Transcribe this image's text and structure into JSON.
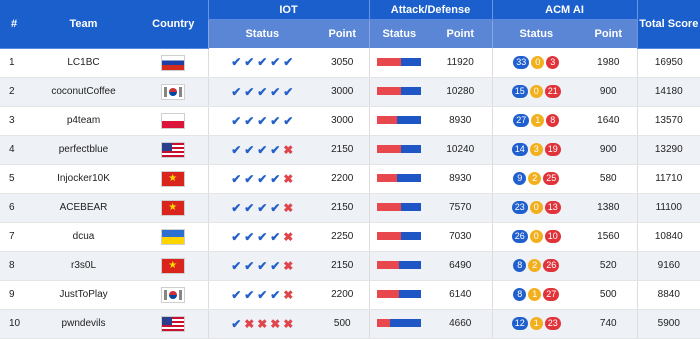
{
  "colors": {
    "header": "#1a5fcc",
    "subheader": "#5b86d6",
    "ok": "#2460c8",
    "bad": "#e0454b",
    "bar_red": "#e8484d",
    "bar_blue": "#1e56c6",
    "pill_blue": "#1f5fce",
    "pill_yellow": "#f2b01e",
    "pill_red": "#e0333a"
  },
  "headers": {
    "rank": "#",
    "team": "Team",
    "country": "Country",
    "iot": "IOT",
    "attack_defense": "Attack/Defense",
    "acm_ai": "ACM AI",
    "total": "Total Score",
    "status": "Status",
    "point": "Point"
  },
  "rows": [
    {
      "rank": "1",
      "team": "LC1BC",
      "country": "ru",
      "iot": [
        "ok",
        "ok",
        "ok",
        "ok",
        "ok"
      ],
      "iot_point": "3050",
      "ad_red_pct": 0.55,
      "ad_point": "11920",
      "acm": [
        "33",
        "0",
        "3"
      ],
      "acm_point": "1980",
      "total": "16950"
    },
    {
      "rank": "2",
      "team": "coconutCoffee",
      "country": "kr",
      "iot": [
        "ok",
        "ok",
        "ok",
        "ok",
        "ok"
      ],
      "iot_point": "3000",
      "ad_red_pct": 0.55,
      "ad_point": "10280",
      "acm": [
        "15",
        "0",
        "21"
      ],
      "acm_point": "900",
      "total": "14180"
    },
    {
      "rank": "3",
      "team": "p4team",
      "country": "pl",
      "iot": [
        "ok",
        "ok",
        "ok",
        "ok",
        "ok"
      ],
      "iot_point": "3000",
      "ad_red_pct": 0.45,
      "ad_point": "8930",
      "acm": [
        "27",
        "1",
        "8"
      ],
      "acm_point": "1640",
      "total": "13570"
    },
    {
      "rank": "4",
      "team": "perfectblue",
      "country": "us",
      "iot": [
        "ok",
        "ok",
        "ok",
        "ok",
        "bad"
      ],
      "iot_point": "2150",
      "ad_red_pct": 0.55,
      "ad_point": "10240",
      "acm": [
        "14",
        "3",
        "19"
      ],
      "acm_point": "900",
      "total": "13290"
    },
    {
      "rank": "5",
      "team": "Injocker10K",
      "country": "vn",
      "iot": [
        "ok",
        "ok",
        "ok",
        "ok",
        "bad"
      ],
      "iot_point": "2200",
      "ad_red_pct": 0.45,
      "ad_point": "8930",
      "acm": [
        "9",
        "2",
        "25"
      ],
      "acm_point": "580",
      "total": "11710"
    },
    {
      "rank": "6",
      "team": "ACEBEAR",
      "country": "vn",
      "iot": [
        "ok",
        "ok",
        "ok",
        "ok",
        "bad"
      ],
      "iot_point": "2150",
      "ad_red_pct": 0.55,
      "ad_point": "7570",
      "acm": [
        "23",
        "0",
        "13"
      ],
      "acm_point": "1380",
      "total": "11100"
    },
    {
      "rank": "7",
      "team": "dcua",
      "country": "ua",
      "iot": [
        "ok",
        "ok",
        "ok",
        "ok",
        "bad"
      ],
      "iot_point": "2250",
      "ad_red_pct": 0.55,
      "ad_point": "7030",
      "acm": [
        "26",
        "0",
        "10"
      ],
      "acm_point": "1560",
      "total": "10840"
    },
    {
      "rank": "8",
      "team": "r3s0L",
      "country": "vn",
      "iot": [
        "ok",
        "ok",
        "ok",
        "ok",
        "bad"
      ],
      "iot_point": "2150",
      "ad_red_pct": 0.5,
      "ad_point": "6490",
      "acm": [
        "8",
        "2",
        "26"
      ],
      "acm_point": "520",
      "total": "9160"
    },
    {
      "rank": "9",
      "team": "JustToPlay",
      "country": "kr",
      "iot": [
        "ok",
        "ok",
        "ok",
        "ok",
        "bad"
      ],
      "iot_point": "2200",
      "ad_red_pct": 0.5,
      "ad_point": "6140",
      "acm": [
        "8",
        "1",
        "27"
      ],
      "acm_point": "500",
      "total": "8840"
    },
    {
      "rank": "10",
      "team": "pwndevils",
      "country": "us",
      "iot": [
        "ok",
        "bad",
        "bad",
        "bad",
        "bad"
      ],
      "iot_point": "500",
      "ad_red_pct": 0.3,
      "ad_point": "4660",
      "acm": [
        "12",
        "1",
        "23"
      ],
      "acm_point": "740",
      "total": "5900"
    }
  ]
}
